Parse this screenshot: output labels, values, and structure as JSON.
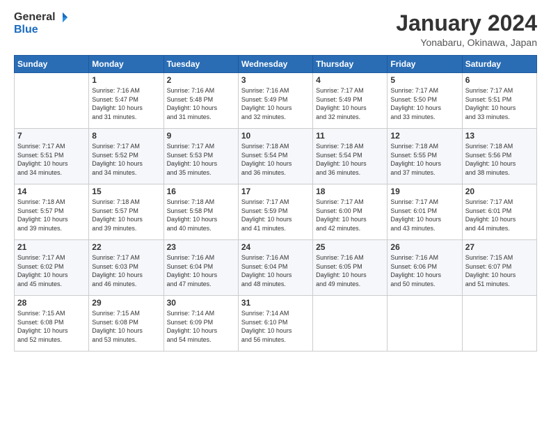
{
  "header": {
    "logo_general": "General",
    "logo_blue": "Blue",
    "month_title": "January 2024",
    "location": "Yonabaru, Okinawa, Japan"
  },
  "days_of_week": [
    "Sunday",
    "Monday",
    "Tuesday",
    "Wednesday",
    "Thursday",
    "Friday",
    "Saturday"
  ],
  "weeks": [
    [
      {
        "day": "",
        "info": ""
      },
      {
        "day": "1",
        "info": "Sunrise: 7:16 AM\nSunset: 5:47 PM\nDaylight: 10 hours\nand 31 minutes."
      },
      {
        "day": "2",
        "info": "Sunrise: 7:16 AM\nSunset: 5:48 PM\nDaylight: 10 hours\nand 31 minutes."
      },
      {
        "day": "3",
        "info": "Sunrise: 7:16 AM\nSunset: 5:49 PM\nDaylight: 10 hours\nand 32 minutes."
      },
      {
        "day": "4",
        "info": "Sunrise: 7:17 AM\nSunset: 5:49 PM\nDaylight: 10 hours\nand 32 minutes."
      },
      {
        "day": "5",
        "info": "Sunrise: 7:17 AM\nSunset: 5:50 PM\nDaylight: 10 hours\nand 33 minutes."
      },
      {
        "day": "6",
        "info": "Sunrise: 7:17 AM\nSunset: 5:51 PM\nDaylight: 10 hours\nand 33 minutes."
      }
    ],
    [
      {
        "day": "7",
        "info": "Sunrise: 7:17 AM\nSunset: 5:51 PM\nDaylight: 10 hours\nand 34 minutes."
      },
      {
        "day": "8",
        "info": "Sunrise: 7:17 AM\nSunset: 5:52 PM\nDaylight: 10 hours\nand 34 minutes."
      },
      {
        "day": "9",
        "info": "Sunrise: 7:17 AM\nSunset: 5:53 PM\nDaylight: 10 hours\nand 35 minutes."
      },
      {
        "day": "10",
        "info": "Sunrise: 7:18 AM\nSunset: 5:54 PM\nDaylight: 10 hours\nand 36 minutes."
      },
      {
        "day": "11",
        "info": "Sunrise: 7:18 AM\nSunset: 5:54 PM\nDaylight: 10 hours\nand 36 minutes."
      },
      {
        "day": "12",
        "info": "Sunrise: 7:18 AM\nSunset: 5:55 PM\nDaylight: 10 hours\nand 37 minutes."
      },
      {
        "day": "13",
        "info": "Sunrise: 7:18 AM\nSunset: 5:56 PM\nDaylight: 10 hours\nand 38 minutes."
      }
    ],
    [
      {
        "day": "14",
        "info": "Sunrise: 7:18 AM\nSunset: 5:57 PM\nDaylight: 10 hours\nand 39 minutes."
      },
      {
        "day": "15",
        "info": "Sunrise: 7:18 AM\nSunset: 5:57 PM\nDaylight: 10 hours\nand 39 minutes."
      },
      {
        "day": "16",
        "info": "Sunrise: 7:18 AM\nSunset: 5:58 PM\nDaylight: 10 hours\nand 40 minutes."
      },
      {
        "day": "17",
        "info": "Sunrise: 7:17 AM\nSunset: 5:59 PM\nDaylight: 10 hours\nand 41 minutes."
      },
      {
        "day": "18",
        "info": "Sunrise: 7:17 AM\nSunset: 6:00 PM\nDaylight: 10 hours\nand 42 minutes."
      },
      {
        "day": "19",
        "info": "Sunrise: 7:17 AM\nSunset: 6:01 PM\nDaylight: 10 hours\nand 43 minutes."
      },
      {
        "day": "20",
        "info": "Sunrise: 7:17 AM\nSunset: 6:01 PM\nDaylight: 10 hours\nand 44 minutes."
      }
    ],
    [
      {
        "day": "21",
        "info": "Sunrise: 7:17 AM\nSunset: 6:02 PM\nDaylight: 10 hours\nand 45 minutes."
      },
      {
        "day": "22",
        "info": "Sunrise: 7:17 AM\nSunset: 6:03 PM\nDaylight: 10 hours\nand 46 minutes."
      },
      {
        "day": "23",
        "info": "Sunrise: 7:16 AM\nSunset: 6:04 PM\nDaylight: 10 hours\nand 47 minutes."
      },
      {
        "day": "24",
        "info": "Sunrise: 7:16 AM\nSunset: 6:04 PM\nDaylight: 10 hours\nand 48 minutes."
      },
      {
        "day": "25",
        "info": "Sunrise: 7:16 AM\nSunset: 6:05 PM\nDaylight: 10 hours\nand 49 minutes."
      },
      {
        "day": "26",
        "info": "Sunrise: 7:16 AM\nSunset: 6:06 PM\nDaylight: 10 hours\nand 50 minutes."
      },
      {
        "day": "27",
        "info": "Sunrise: 7:15 AM\nSunset: 6:07 PM\nDaylight: 10 hours\nand 51 minutes."
      }
    ],
    [
      {
        "day": "28",
        "info": "Sunrise: 7:15 AM\nSunset: 6:08 PM\nDaylight: 10 hours\nand 52 minutes."
      },
      {
        "day": "29",
        "info": "Sunrise: 7:15 AM\nSunset: 6:08 PM\nDaylight: 10 hours\nand 53 minutes."
      },
      {
        "day": "30",
        "info": "Sunrise: 7:14 AM\nSunset: 6:09 PM\nDaylight: 10 hours\nand 54 minutes."
      },
      {
        "day": "31",
        "info": "Sunrise: 7:14 AM\nSunset: 6:10 PM\nDaylight: 10 hours\nand 56 minutes."
      },
      {
        "day": "",
        "info": ""
      },
      {
        "day": "",
        "info": ""
      },
      {
        "day": "",
        "info": ""
      }
    ]
  ]
}
